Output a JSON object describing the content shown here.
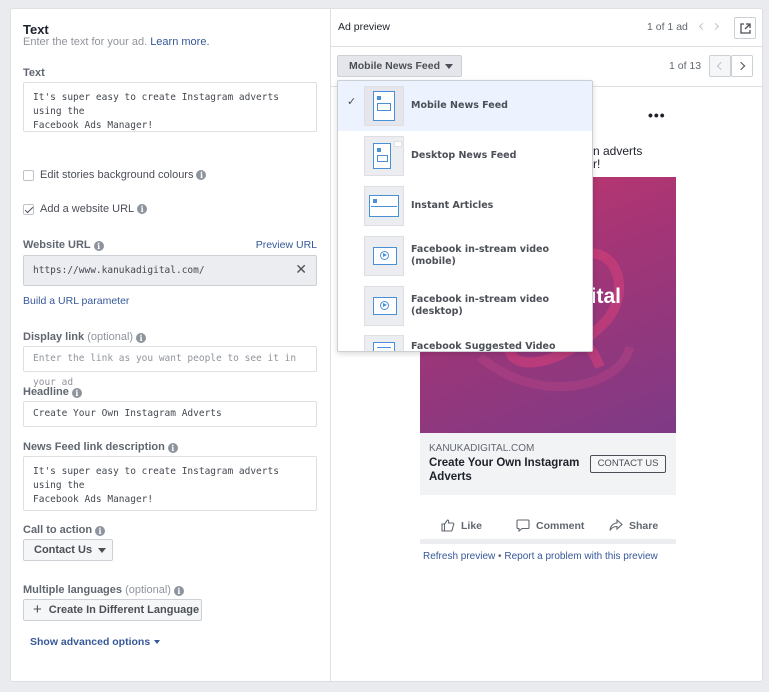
{
  "text_section": {
    "title": "Text",
    "subtitle": "Enter the text for your ad.",
    "learn_more": "Learn more.",
    "text_label": "Text",
    "text_value_line1": "It's super easy to create Instagram adverts using the",
    "text_value_line2": "Facebook Ads Manager!",
    "edit_stories_label": "Edit stories background colours",
    "add_website_label": "Add a website URL",
    "website_url_label": "Website URL",
    "preview_url": "Preview URL",
    "website_url_value": "https://www.kanukadigital.com/",
    "build_url_param": "Build a URL parameter",
    "display_link_label": "Display link",
    "display_link_optional": "(optional)",
    "display_link_placeholder": "Enter the link as you want people to see it in your ad",
    "headline_label": "Headline",
    "headline_value": "Create Your Own Instagram Adverts",
    "news_feed_desc_label": "News Feed link description",
    "news_feed_desc_line1": "It's super easy to create Instagram adverts using the",
    "news_feed_desc_line2": "Facebook Ads Manager!",
    "cta_label": "Call to action",
    "cta_value": "Contact Us",
    "multi_lang_label": "Multiple languages",
    "multi_lang_optional": "(optional)",
    "create_lang_button": "Create In Different Language",
    "advanced_options": "Show advanced options"
  },
  "preview": {
    "title": "Ad preview",
    "ad_count": "1 of 1 ad",
    "placement_selected": "Mobile News Feed",
    "placement_count": "1 of 13",
    "placements": [
      {
        "label": "Mobile News Feed",
        "selected": true
      },
      {
        "label": "Desktop News Feed",
        "selected": false
      },
      {
        "label": "Instant Articles",
        "selected": false
      },
      {
        "label_line1": "Facebook in-stream video",
        "label_line2": "(mobile)",
        "selected": false
      },
      {
        "label_line1": "Facebook in-stream video",
        "label_line2": "(desktop)",
        "selected": false
      },
      {
        "label": "Facebook Suggested Video",
        "selected": false
      }
    ],
    "body_partial_line1": "n adverts",
    "body_partial_line2": "r!",
    "image_text": "igital",
    "domain": "KANUKADIGITAL.COM",
    "headline_line1": "Create Your Own Instagram",
    "headline_line2": "Adverts",
    "cta_button": "CONTACT US",
    "like": "Like",
    "comment": "Comment",
    "share": "Share",
    "refresh": "Refresh preview",
    "separator": "•",
    "report": "Report a problem with this preview",
    "more_dots": "•••"
  },
  "colors": {
    "link": "#365899",
    "selected_bg": "#ecf3ff",
    "image_gradient_start": "#c2366e",
    "image_gradient_end": "#7e3a86"
  }
}
